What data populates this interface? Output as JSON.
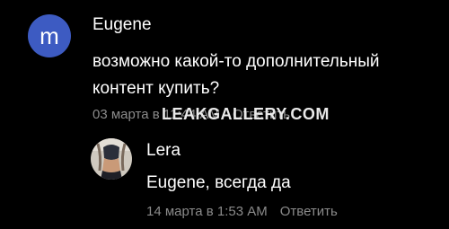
{
  "comments": [
    {
      "author": "Eugene",
      "avatar_letter": "m",
      "avatar_color": "#3d5bc2",
      "text_line1": "возможно какой-то дополнительный",
      "text_line2": "контент купить?",
      "date": "03 марта в 11:44 AM",
      "reply": "Ответить"
    },
    {
      "author": "Lera",
      "text": "Eugene, всегда да",
      "date": "14 марта в 1:53 AM",
      "reply": "Ответить"
    }
  ],
  "watermark": "LEAKGALLERY.COM",
  "colors": {
    "background": "#000000",
    "text": "#ffffff",
    "meta": "#8b8b8b"
  }
}
